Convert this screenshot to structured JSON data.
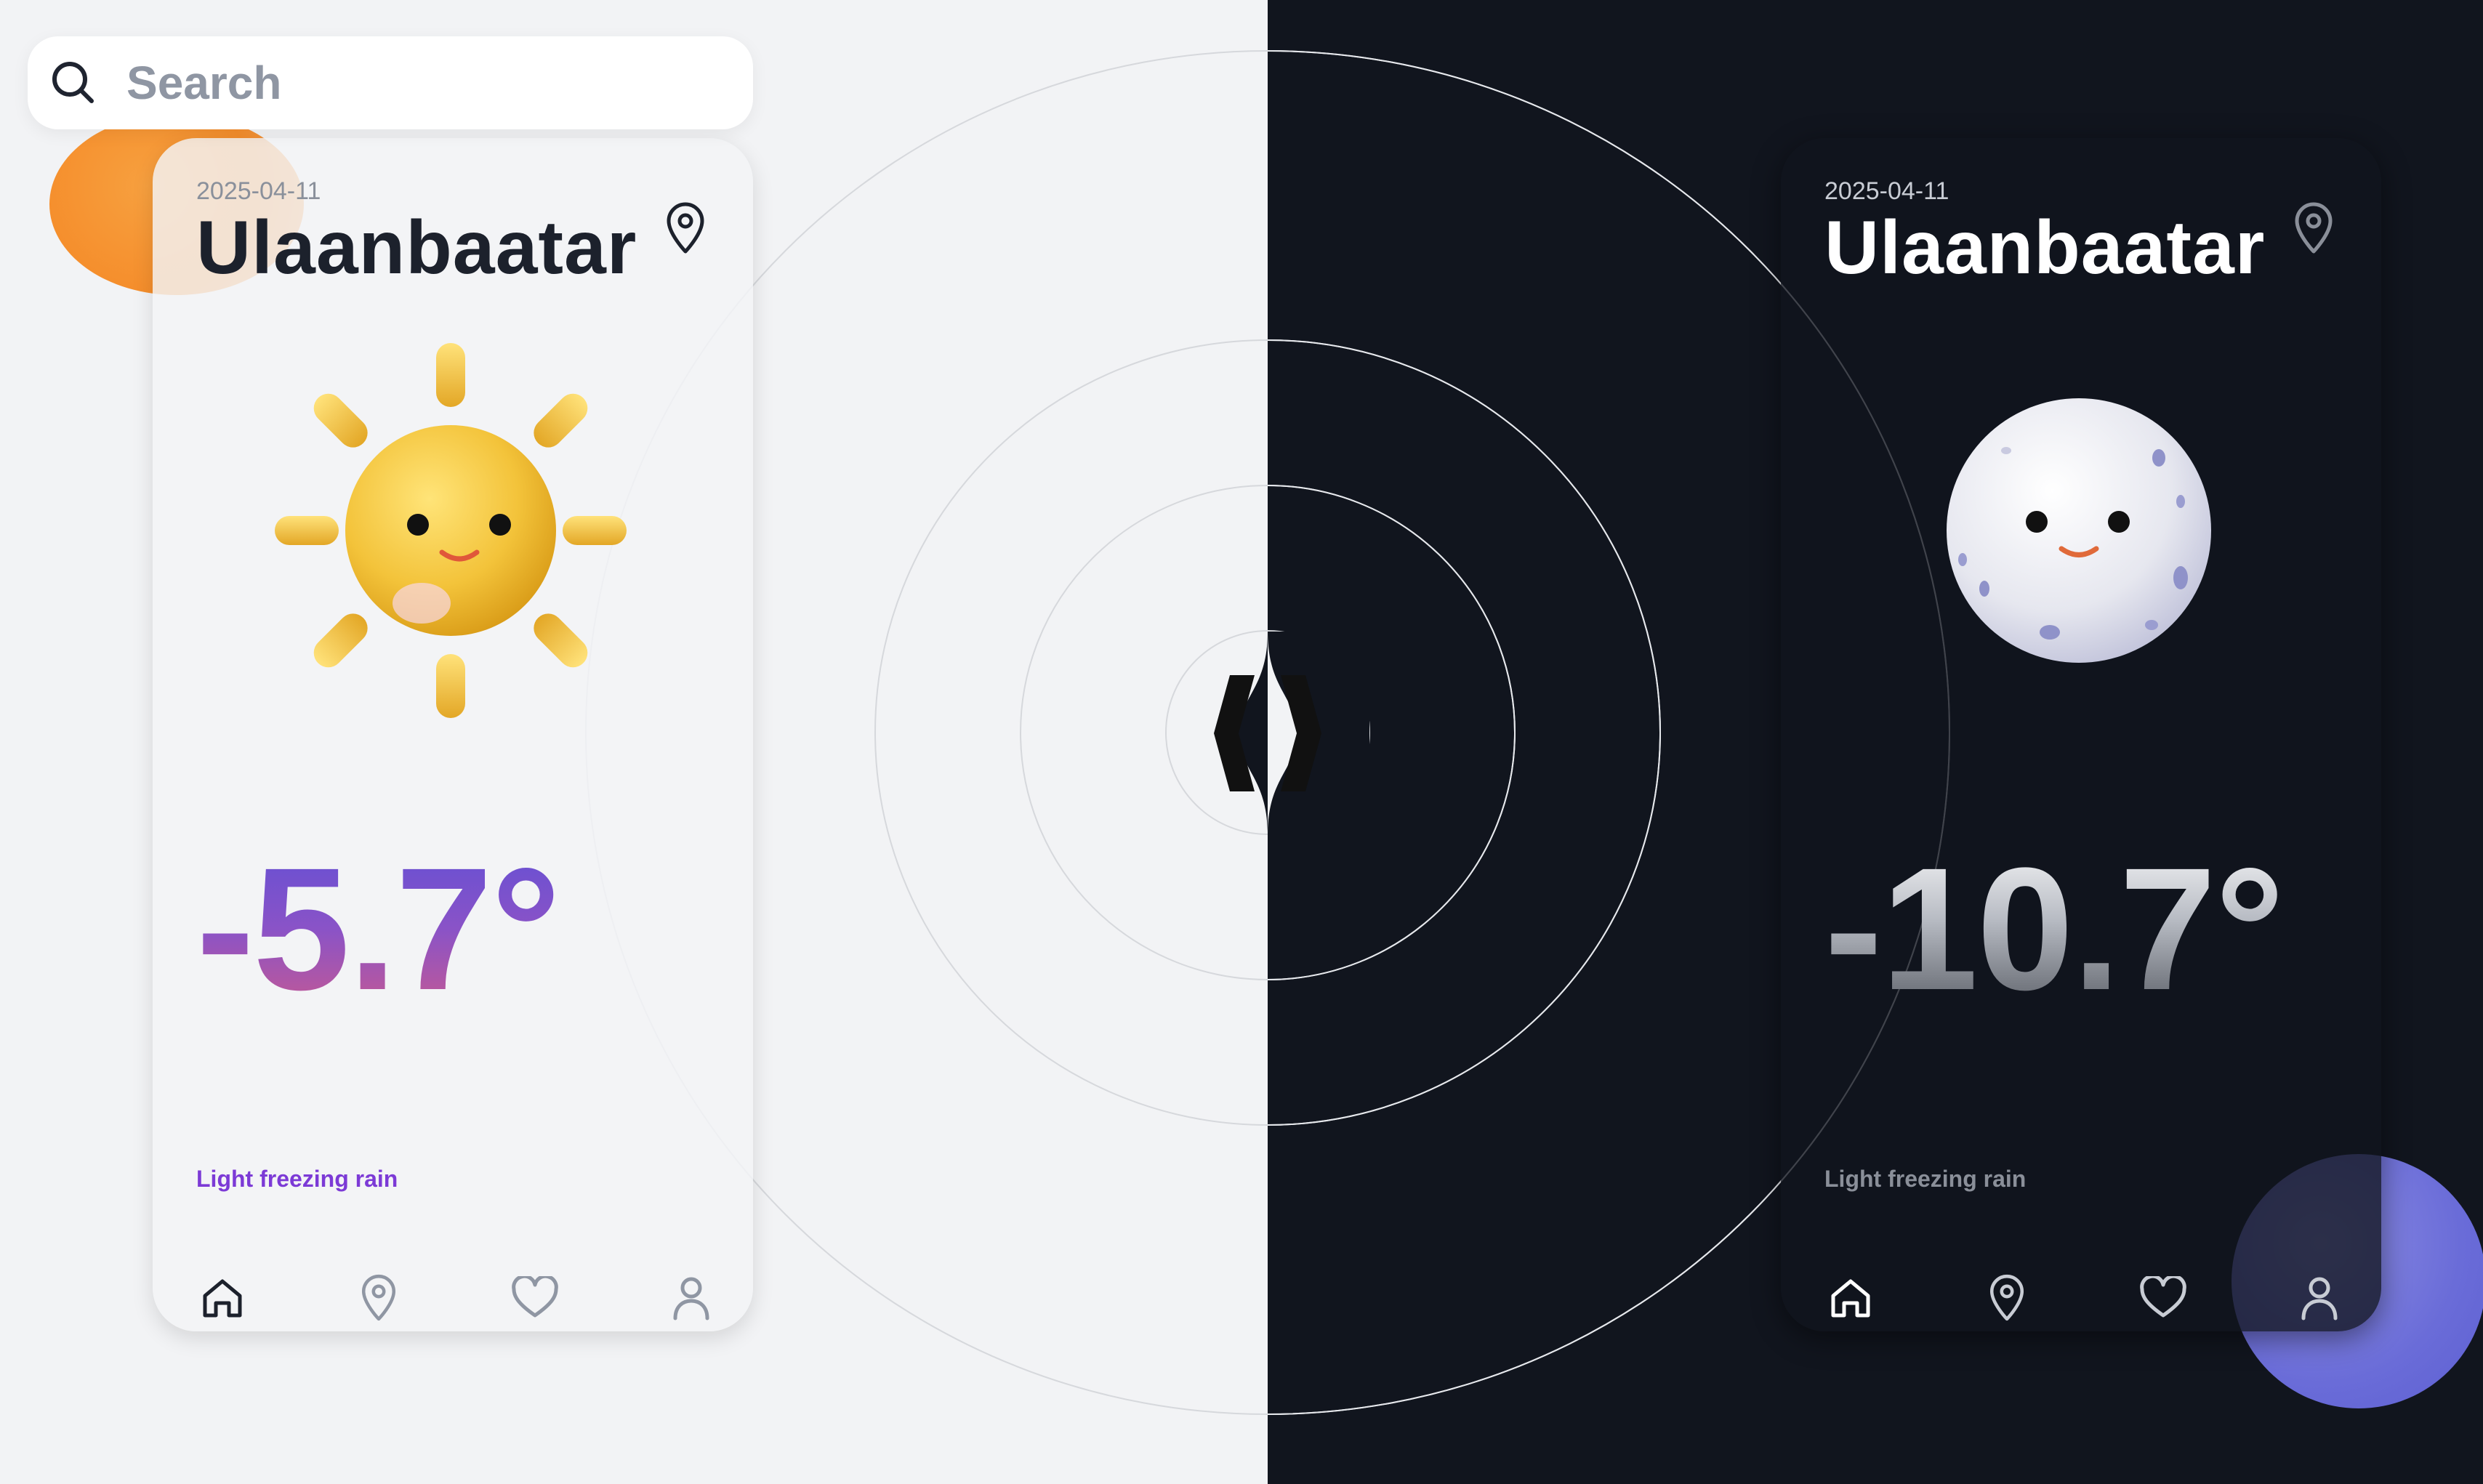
{
  "search": {
    "placeholder": "Search"
  },
  "light_card": {
    "date": "2025-04-11",
    "city": "Ulaanbaatar",
    "temperature": "-5.7°",
    "condition": "Light freezing rain"
  },
  "dark_card": {
    "date": "2025-04-11",
    "city": "Ulaanbaatar",
    "temperature": "-10.7°",
    "condition": "Light freezing rain"
  },
  "nav": {
    "items": [
      {
        "icon": "home-icon",
        "active": true
      },
      {
        "icon": "location-pin-icon",
        "active": false
      },
      {
        "icon": "heart-icon",
        "active": false
      },
      {
        "icon": "user-icon",
        "active": false
      }
    ]
  },
  "colors": {
    "light_bg": "#f2f3f5",
    "dark_bg": "#11151e",
    "temp_gradient_light": [
      "#5e4fd6",
      "#d05a89"
    ],
    "condition_light": "#7c3ad6",
    "orange_accent": "#f58e2c",
    "purple_accent": "#6a6cd8"
  }
}
